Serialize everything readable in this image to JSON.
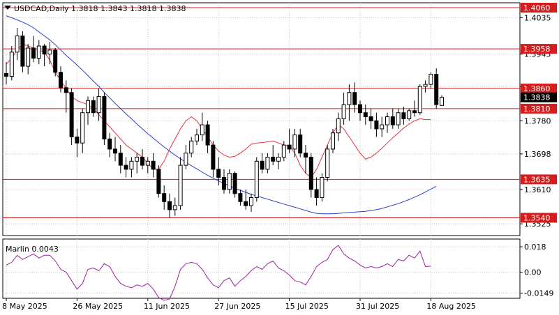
{
  "header": {
    "symbol_line": "USDCAD,Daily  1.3818 1.3843 1.3818 1.3838",
    "indicator_line": "Marlin 0.0043"
  },
  "colors": {
    "background": "#ffffff",
    "plot_bg": "#f0f0f0",
    "grid": "#c8c8c8",
    "candle": "#000000",
    "ma_fast": "#e6323c",
    "ma_slow": "#2a3fd4",
    "levels": "#d21e1e",
    "marlin": "#a020a0",
    "current_tag": "#000000"
  },
  "chart_data": [
    {
      "type": "candlestick",
      "title": "USDCAD,Daily",
      "ylim": [
        1.3496,
        1.4072
      ],
      "y_ticks": [
        1.4035,
        1.3945,
        1.3865,
        1.378,
        1.3698,
        1.361,
        1.3525
      ],
      "x_tick_labels": [
        {
          "index": 0,
          "label": "8 May 2025"
        },
        {
          "index": 13,
          "label": "26 May 2025"
        },
        {
          "index": 26,
          "label": "11 Jun 2025"
        },
        {
          "index": 39,
          "label": "27 Jun 2025"
        },
        {
          "index": 52,
          "label": "15 Jul 2025"
        },
        {
          "index": 65,
          "label": "31 Jul 2025"
        },
        {
          "index": 78,
          "label": "18 Aug 2025"
        }
      ],
      "price_levels": [
        {
          "value": 1.406,
          "label": "1.4060"
        },
        {
          "value": 1.3958,
          "label": "1.3958"
        },
        {
          "value": 1.386,
          "label": "1.3860"
        },
        {
          "value": 1.381,
          "label": "1.3810"
        },
        {
          "value": 1.3635,
          "label": "1.3635"
        },
        {
          "value": 1.354,
          "label": "1.3540"
        }
      ],
      "current_price": {
        "value": 1.3838,
        "label": "1.3838"
      },
      "candles": [
        [
          1.3897,
          1.3925,
          1.387,
          1.389
        ],
        [
          1.389,
          1.3965,
          1.388,
          1.395
        ],
        [
          1.395,
          1.401,
          1.393,
          1.399
        ],
        [
          1.399,
          1.4002,
          1.39,
          1.3915
        ],
        [
          1.3915,
          1.397,
          1.3895,
          1.396
        ],
        [
          1.396,
          1.399,
          1.3925,
          1.3935
        ],
        [
          1.3935,
          1.398,
          1.392,
          1.3965
        ],
        [
          1.3965,
          1.397,
          1.3915,
          1.3945
        ],
        [
          1.3945,
          1.3975,
          1.392,
          1.3955
        ],
        [
          1.3955,
          1.396,
          1.389,
          1.39
        ],
        [
          1.39,
          1.3915,
          1.385,
          1.3862
        ],
        [
          1.3862,
          1.388,
          1.38,
          1.385
        ],
        [
          1.385,
          1.386,
          1.372,
          1.374
        ],
        [
          1.374,
          1.376,
          1.369,
          1.3725
        ],
        [
          1.3725,
          1.381,
          1.37,
          1.38
        ],
        [
          1.38,
          1.384,
          1.377,
          1.383
        ],
        [
          1.383,
          1.384,
          1.379,
          1.38
        ],
        [
          1.38,
          1.386,
          1.378,
          1.384
        ],
        [
          1.384,
          1.385,
          1.372,
          1.3735
        ],
        [
          1.3735,
          1.375,
          1.369,
          1.371
        ],
        [
          1.371,
          1.374,
          1.368,
          1.37
        ],
        [
          1.37,
          1.372,
          1.365,
          1.367
        ],
        [
          1.367,
          1.369,
          1.364,
          1.366
        ],
        [
          1.366,
          1.369,
          1.364,
          1.368
        ],
        [
          1.368,
          1.37,
          1.365,
          1.369
        ],
        [
          1.369,
          1.371,
          1.366,
          1.367
        ],
        [
          1.367,
          1.369,
          1.365,
          1.368
        ],
        [
          1.368,
          1.37,
          1.364,
          1.366
        ],
        [
          1.366,
          1.367,
          1.359,
          1.36
        ],
        [
          1.36,
          1.362,
          1.356,
          1.358
        ],
        [
          1.358,
          1.36,
          1.354,
          1.356
        ],
        [
          1.356,
          1.359,
          1.3545,
          1.357
        ],
        [
          1.357,
          1.369,
          1.356,
          1.367
        ],
        [
          1.367,
          1.372,
          1.366,
          1.37
        ],
        [
          1.37,
          1.374,
          1.369,
          1.373
        ],
        [
          1.373,
          1.376,
          1.372,
          1.3745
        ],
        [
          1.3745,
          1.38,
          1.373,
          1.377
        ],
        [
          1.377,
          1.378,
          1.37,
          1.372
        ],
        [
          1.372,
          1.373,
          1.364,
          1.366
        ],
        [
          1.366,
          1.369,
          1.362,
          1.364
        ],
        [
          1.364,
          1.366,
          1.36,
          1.361
        ],
        [
          1.361,
          1.366,
          1.36,
          1.365
        ],
        [
          1.365,
          1.3655,
          1.359,
          1.36
        ],
        [
          1.36,
          1.361,
          1.357,
          1.358
        ],
        [
          1.358,
          1.361,
          1.356,
          1.357
        ],
        [
          1.357,
          1.36,
          1.3555,
          1.359
        ],
        [
          1.359,
          1.369,
          1.358,
          1.368
        ],
        [
          1.368,
          1.37,
          1.365,
          1.366
        ],
        [
          1.366,
          1.37,
          1.365,
          1.369
        ],
        [
          1.369,
          1.372,
          1.367,
          1.368
        ],
        [
          1.368,
          1.37,
          1.366,
          1.369
        ],
        [
          1.369,
          1.373,
          1.368,
          1.372
        ],
        [
          1.372,
          1.376,
          1.37,
          1.371
        ],
        [
          1.371,
          1.376,
          1.369,
          1.3745
        ],
        [
          1.3745,
          1.376,
          1.369,
          1.37
        ],
        [
          1.37,
          1.372,
          1.365,
          1.369
        ],
        [
          1.369,
          1.37,
          1.359,
          1.361
        ],
        [
          1.361,
          1.364,
          1.357,
          1.359
        ],
        [
          1.359,
          1.365,
          1.358,
          1.364
        ],
        [
          1.364,
          1.372,
          1.363,
          1.371
        ],
        [
          1.371,
          1.376,
          1.37,
          1.375
        ],
        [
          1.375,
          1.38,
          1.373,
          1.3785
        ],
        [
          1.3785,
          1.385,
          1.377,
          1.382
        ],
        [
          1.382,
          1.387,
          1.378,
          1.385
        ],
        [
          1.385,
          1.3875,
          1.38,
          1.382
        ],
        [
          1.382,
          1.383,
          1.378,
          1.38
        ],
        [
          1.38,
          1.382,
          1.377,
          1.379
        ],
        [
          1.379,
          1.381,
          1.376,
          1.378
        ],
        [
          1.378,
          1.38,
          1.374,
          1.376
        ],
        [
          1.376,
          1.379,
          1.374,
          1.377
        ],
        [
          1.377,
          1.38,
          1.375,
          1.379
        ],
        [
          1.379,
          1.381,
          1.376,
          1.377
        ],
        [
          1.377,
          1.381,
          1.376,
          1.38
        ],
        [
          1.38,
          1.3815,
          1.377,
          1.3785
        ],
        [
          1.3785,
          1.381,
          1.378,
          1.3805
        ],
        [
          1.3805,
          1.383,
          1.379,
          1.38
        ],
        [
          1.38,
          1.387,
          1.3795,
          1.3865
        ],
        [
          1.3865,
          1.388,
          1.385,
          1.387
        ],
        [
          1.387,
          1.39,
          1.386,
          1.3895
        ],
        [
          1.3895,
          1.391,
          1.381,
          1.382
        ],
        [
          1.3818,
          1.3843,
          1.3818,
          1.3838
        ]
      ],
      "ma_fast": [
        1.392,
        1.3935,
        1.3955,
        1.397,
        1.3965,
        1.396,
        1.3955,
        1.395,
        1.393,
        1.39,
        1.388,
        1.386,
        1.384,
        1.383,
        1.3825,
        1.382,
        1.381,
        1.3795,
        1.378,
        1.3765,
        1.375,
        1.3735,
        1.372,
        1.371,
        1.37,
        1.369,
        1.3675,
        1.366,
        1.366,
        1.368,
        1.371,
        1.3735,
        1.376,
        1.378,
        1.379,
        1.378,
        1.376,
        1.374,
        1.372,
        1.3705,
        1.3695,
        1.369,
        1.3692,
        1.37,
        1.371,
        1.3722,
        1.3725,
        1.3726,
        1.3728,
        1.373,
        1.3725,
        1.372,
        1.3718,
        1.37,
        1.367,
        1.365,
        1.364,
        1.366,
        1.369,
        1.372,
        1.375,
        1.377,
        1.376,
        1.374,
        1.372,
        1.37,
        1.3685,
        1.369,
        1.37,
        1.3712,
        1.3725,
        1.3738,
        1.375,
        1.3762,
        1.3772,
        1.378,
        1.3785,
        1.3783,
        1.3783
      ],
      "ma_slow": [
        1.404,
        1.4035,
        1.403,
        1.4024,
        1.4018,
        1.401,
        1.4,
        1.399,
        1.398,
        1.3968,
        1.3955,
        1.3942,
        1.393,
        1.3918,
        1.3905,
        1.3892,
        1.3878,
        1.3865,
        1.385,
        1.3837,
        1.3823,
        1.381,
        1.3797,
        1.3785,
        1.3772,
        1.376,
        1.3748,
        1.3737,
        1.3726,
        1.3715,
        1.3705,
        1.3695,
        1.3686,
        1.3677,
        1.3669,
        1.3661,
        1.3653,
        1.3645,
        1.3638,
        1.3631,
        1.3625,
        1.3619,
        1.3613,
        1.3608,
        1.3603,
        1.3598,
        1.3594,
        1.359,
        1.3586,
        1.3582,
        1.3578,
        1.3574,
        1.357,
        1.3566,
        1.3562,
        1.3558,
        1.3554,
        1.3551,
        1.355,
        1.355,
        1.355,
        1.3551,
        1.3552,
        1.3553,
        1.3554,
        1.3555,
        1.3556,
        1.3558,
        1.356,
        1.3563,
        1.3567,
        1.3571,
        1.3575,
        1.358,
        1.3585,
        1.3591,
        1.3597,
        1.3604,
        1.3611,
        1.3618
      ]
    },
    {
      "type": "line",
      "title": "Marlin 0.0043",
      "ylim": [
        -0.0185,
        0.0235
      ],
      "y_ticks": [
        0.018,
        0.0,
        -0.0149
      ],
      "y_tick_labels": [
        "0.018",
        "0.00",
        "-0.0149"
      ],
      "values": [
        0.005,
        0.007,
        0.012,
        0.009,
        0.011,
        0.013,
        0.01,
        0.012,
        0.012,
        0.008,
        0.002,
        0.0,
        -0.006,
        -0.012,
        -0.008,
        0.002,
        0.003,
        0.001,
        0.006,
        0.004,
        -0.003,
        -0.008,
        -0.01,
        -0.011,
        -0.009,
        -0.01,
        -0.008,
        -0.012,
        -0.018,
        -0.02,
        -0.019,
        -0.01,
        0.002,
        0.006,
        0.007,
        0.006,
        0.002,
        -0.004,
        -0.009,
        -0.011,
        -0.006,
        -0.004,
        -0.01,
        -0.006,
        -0.003,
        0.001,
        0.004,
        0.002,
        0.006,
        0.008,
        0.003,
        0.001,
        -0.002,
        -0.006,
        -0.007,
        -0.009,
        -0.003,
        0.004,
        0.007,
        0.009,
        0.016,
        0.019,
        0.013,
        0.01,
        0.008,
        0.005,
        0.003,
        0.004,
        0.003,
        0.004,
        0.006,
        0.004,
        0.009,
        0.008,
        0.012,
        0.01,
        0.015,
        0.004,
        0.0043
      ]
    }
  ]
}
